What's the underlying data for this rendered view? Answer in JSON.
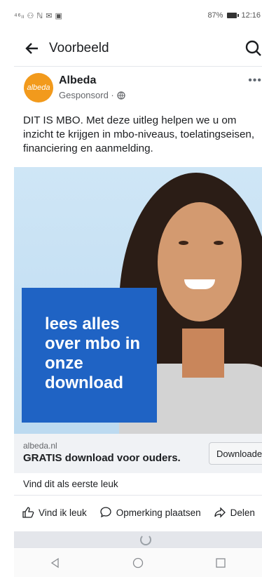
{
  "status_bar": {
    "signal": "⁴⁶ₗₗ ⚇ ℕ ✉ ▣",
    "battery": "87%",
    "time": "12:16"
  },
  "header": {
    "title": "Voorbeeld",
    "back_icon": "arrow-left-icon",
    "search_icon": "search-icon"
  },
  "post": {
    "avatar_text": "albeda",
    "page_name": "Albeda",
    "sponsored": "Gesponsord ·",
    "more": "•••",
    "text": "DIT IS MBO. Met deze uitleg helpen we u om inzicht te krijgen in mbo-niveaus, toelatingseisen, financiering en aanmelding.",
    "image_overlay": "lees alles over mbo in onze download"
  },
  "cta": {
    "domain": "albeda.nl",
    "headline": "GRATIS download voor ouders.",
    "button": "Downloaden"
  },
  "engagement": {
    "first_like": "Vind dit als eerste leuk",
    "like": "Vind ik leuk",
    "comment": "Opmerking plaatsen",
    "share": "Delen"
  },
  "colors": {
    "accent": "#1f63c4",
    "avatar": "#f29a1c"
  }
}
